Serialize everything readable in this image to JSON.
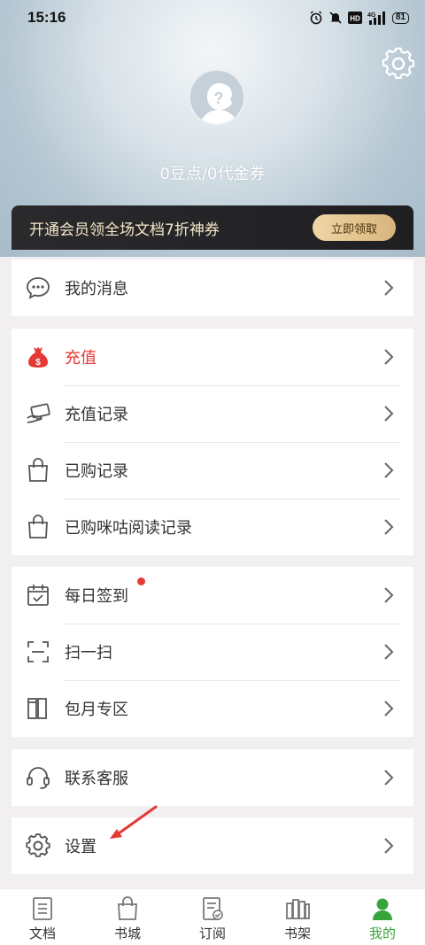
{
  "status_bar": {
    "time": "15:16",
    "battery": "81",
    "network": "4G"
  },
  "profile": {
    "balance": "0豆点/0代金券"
  },
  "vip_banner": {
    "text": "开通会员领全场文档7折神券",
    "button": "立即领取"
  },
  "menu": {
    "messages": "我的消息",
    "recharge": "充值",
    "recharge_records": "充值记录",
    "purchase_records": "已购记录",
    "migu_records": "已购咪咕阅读记录",
    "daily_checkin": "每日签到",
    "scan": "扫一扫",
    "monthly_zone": "包月专区",
    "customer_service": "联系客服",
    "settings": "设置"
  },
  "tabs": [
    {
      "label": "文档",
      "icon": "document-icon"
    },
    {
      "label": "书城",
      "icon": "shopping-bag-icon"
    },
    {
      "label": "订阅",
      "icon": "subscription-icon"
    },
    {
      "label": "书架",
      "icon": "bookshelf-icon"
    },
    {
      "label": "我的",
      "icon": "person-icon",
      "active": true
    }
  ],
  "colors": {
    "accent": "#e53935",
    "active_tab": "#38a53c",
    "banner_gold": "#e6c590"
  }
}
